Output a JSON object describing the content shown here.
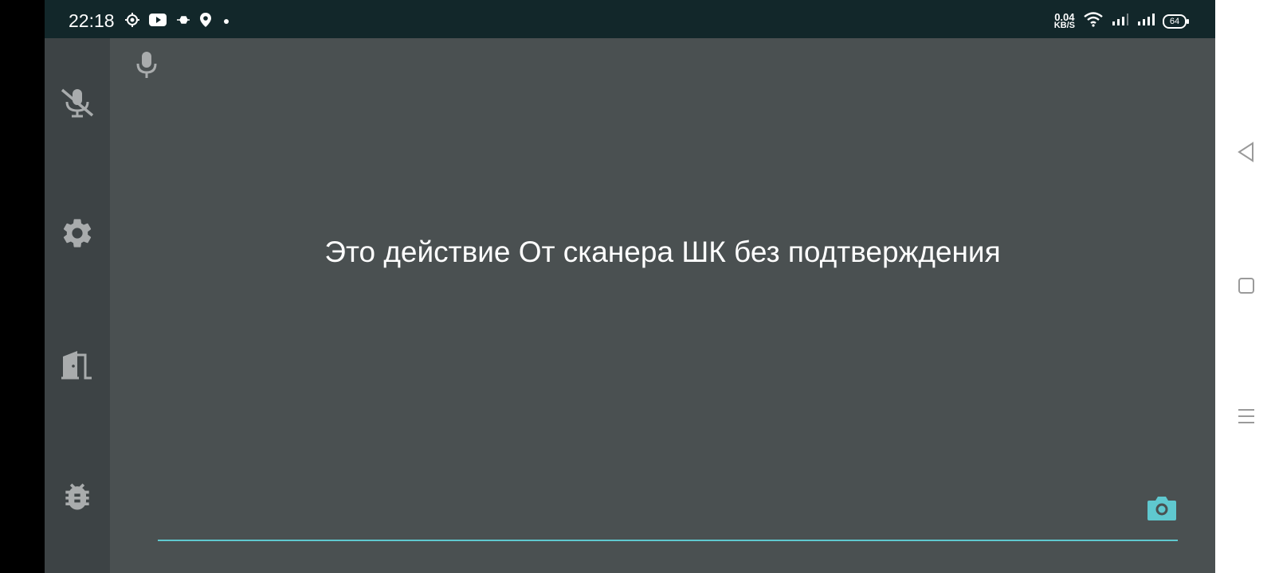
{
  "status_bar": {
    "time": "22:18",
    "net_speed_value": "0.04",
    "net_speed_unit": "KB/S",
    "battery": "64",
    "left_icons": [
      "app-notification-icon",
      "youtube-icon",
      "usb-debug-icon",
      "location-icon",
      "dot-icon"
    ],
    "right_icons": [
      "wifi-icon",
      "signal-1-icon",
      "signal-2-icon",
      "battery-icon"
    ]
  },
  "sidebar": {
    "items": [
      {
        "icon": "mic-off-icon",
        "action": "mute"
      },
      {
        "icon": "gear-icon",
        "action": "settings"
      },
      {
        "icon": "exit-door-icon",
        "action": "exit"
      },
      {
        "icon": "bug-icon",
        "action": "debug"
      }
    ]
  },
  "main": {
    "mic_icon": "mic-icon",
    "message": "Это действие От сканера ШК без подтверждения",
    "camera_icon": "camera-icon"
  },
  "nav_bar": {
    "buttons": [
      "back-icon",
      "home-icon",
      "menu-icon"
    ]
  },
  "colors": {
    "status_bar_bg": "#12272a",
    "sidebar_bg": "#3d4345",
    "main_bg": "#4a5051",
    "accent": "#5fc8cf",
    "icon_gray": "#a9acad"
  }
}
